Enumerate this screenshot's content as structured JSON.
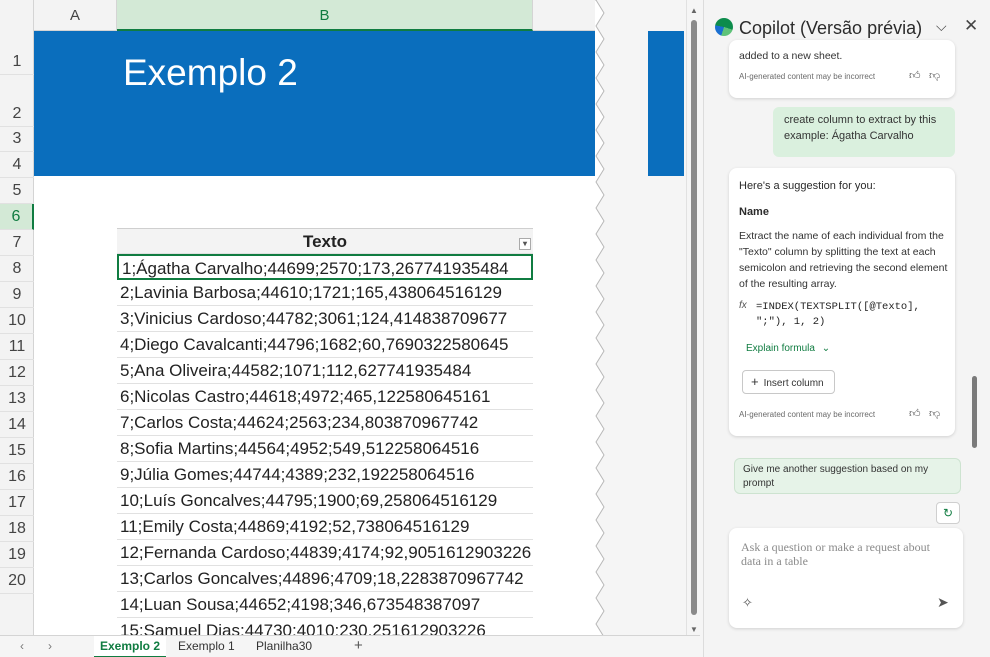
{
  "sheet": {
    "columns": [
      "A",
      "B"
    ],
    "title": "Exemplo 2",
    "row_numbers": [
      "1",
      "2",
      "3",
      "4",
      "5",
      "6",
      "7",
      "8",
      "9",
      "10",
      "11",
      "12",
      "13",
      "14",
      "15",
      "16",
      "17",
      "18",
      "19",
      "20"
    ],
    "table_header": "Texto",
    "rows": [
      "1;Ágatha Carvalho;44699;2570;173,267741935484",
      "2;Lavinia Barbosa;44610;1721;165,438064516129",
      "3;Vinicius Cardoso;44782;3061;124,414838709677",
      "4;Diego Cavalcanti;44796;1682;60,7690322580645",
      "5;Ana Oliveira;44582;1071;112,627741935484",
      "6;Nicolas Castro;44618;4972;465,122580645161",
      "7;Carlos Costa;44624;2563;234,803870967742",
      "8;Sofia Martins;44564;4952;549,512258064516",
      "9;Júlia Gomes;44744;4389;232,192258064516",
      "10;Luís Goncalves;44795;1900;69,258064516129",
      "11;Emily Costa;44869;4192;52,738064516129",
      "12;Fernanda Cardoso;44839;4174;92,9051612903226",
      "13;Carlos Goncalves;44896;4709;18,2283870967742",
      "14;Luan Sousa;44652;4198;346,673548387097",
      "15;Samuel Dias;44730;4010;230,251612903226"
    ]
  },
  "tabs": {
    "items": [
      "Exemplo 2",
      "Exemplo 1",
      "Planilha30"
    ],
    "add": "+"
  },
  "copilot": {
    "title": "Copilot (Versão prévia)",
    "prev_message_tail": "added to a new sheet.",
    "ai_disclaimer": "AI-generated content may be incorrect",
    "user_message": "create column to extract by this example: Ágatha Carvalho",
    "suggestion": {
      "intro": "Here's a suggestion for you:",
      "name": "Name",
      "description": "Extract the name of each individual from the \"Texto\" column by splitting the text at each semicolon and retrieving the second element of the resulting array.",
      "fx": "fx",
      "formula": "=INDEX(TEXTSPLIT([@Texto], \";\"), 1, 2)",
      "explain_label": "Explain formula",
      "insert_label": "Insert column"
    },
    "chip": "Give me another suggestion based on my prompt",
    "input_placeholder": "Ask a question or make a request about data in a table"
  },
  "colors": {
    "accent_green": "#107c41",
    "title_blue": "#0a6ebd"
  }
}
